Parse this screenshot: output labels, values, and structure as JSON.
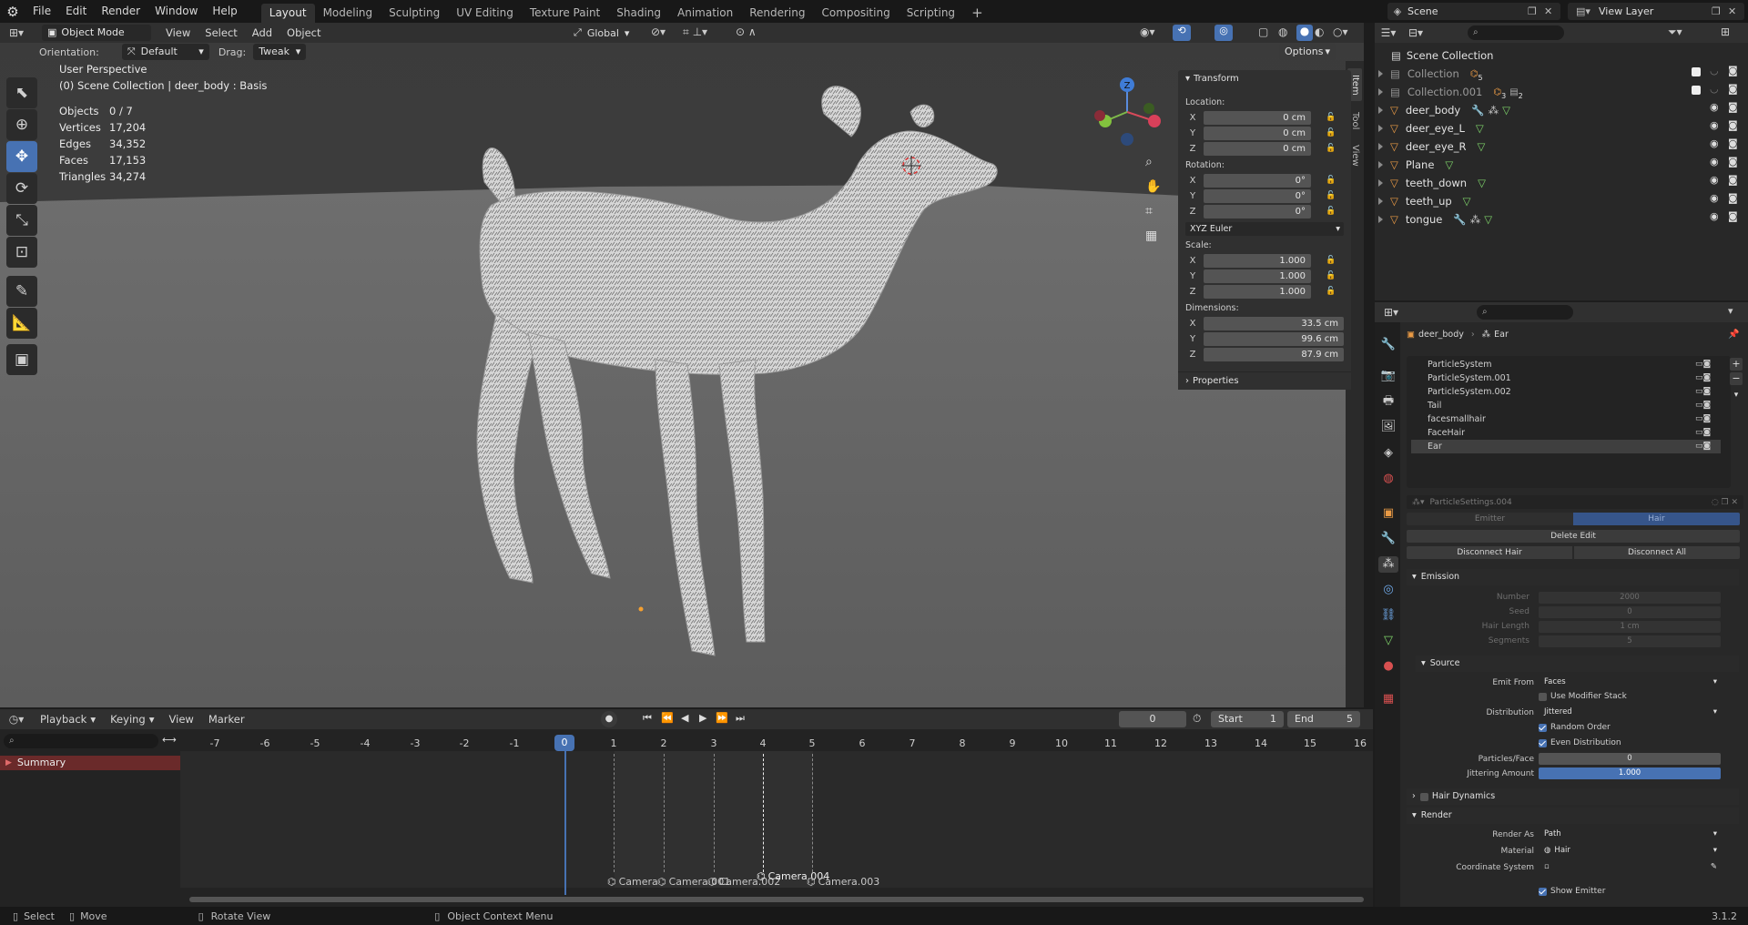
{
  "menu": {
    "items": [
      "File",
      "Edit",
      "Render",
      "Window",
      "Help"
    ]
  },
  "workspaces": {
    "tabs": [
      "Layout",
      "Modeling",
      "Sculpting",
      "UV Editing",
      "Texture Paint",
      "Shading",
      "Animation",
      "Rendering",
      "Compositing",
      "Scripting"
    ],
    "active": "Layout",
    "add": "+"
  },
  "scene": {
    "name": "Scene",
    "view_layer": "View Layer"
  },
  "viewport_header": {
    "mode": "Object Mode",
    "menus": [
      "View",
      "Select",
      "Add",
      "Object"
    ],
    "transform": "Global",
    "options": "Options"
  },
  "tool_settings": {
    "orientation_label": "Orientation:",
    "orientation_value": "Default",
    "drag_label": "Drag:",
    "drag_value": "Tweak"
  },
  "viewport_info": {
    "perspective": "User Perspective",
    "context": "(0) Scene Collection | deer_body : Basis",
    "stats": [
      {
        "key": "Objects",
        "value": "0 / 7"
      },
      {
        "key": "Vertices",
        "value": "17,204"
      },
      {
        "key": "Edges",
        "value": "34,352"
      },
      {
        "key": "Faces",
        "value": "17,153"
      },
      {
        "key": "Triangles",
        "value": "34,274"
      }
    ]
  },
  "npanel": {
    "tabs": [
      "Item",
      "Tool",
      "View"
    ],
    "transform_title": "Transform",
    "location_label": "Location:",
    "location": [
      {
        "axis": "X",
        "value": "0 cm"
      },
      {
        "axis": "Y",
        "value": "0 cm"
      },
      {
        "axis": "Z",
        "value": "0 cm"
      }
    ],
    "rotation_label": "Rotation:",
    "rotation": [
      {
        "axis": "X",
        "value": "0°"
      },
      {
        "axis": "Y",
        "value": "0°"
      },
      {
        "axis": "Z",
        "value": "0°"
      }
    ],
    "rotation_mode": "XYZ Euler",
    "scale_label": "Scale:",
    "scale": [
      {
        "axis": "X",
        "value": "1.000"
      },
      {
        "axis": "Y",
        "value": "1.000"
      },
      {
        "axis": "Z",
        "value": "1.000"
      }
    ],
    "dimensions_label": "Dimensions:",
    "dimensions": [
      {
        "axis": "X",
        "value": "33.5 cm"
      },
      {
        "axis": "Y",
        "value": "99.6 cm"
      },
      {
        "axis": "Z",
        "value": "87.9 cm"
      }
    ],
    "properties_title": "Properties"
  },
  "gizmo": {
    "x": "X",
    "y": "Y",
    "z": "Z"
  },
  "outliner": {
    "root": "Scene Collection",
    "items": [
      {
        "name": "Collection",
        "badge": "5"
      },
      {
        "name": "Collection.001",
        "badge": "3"
      },
      {
        "name": "deer_body"
      },
      {
        "name": "deer_eye_L"
      },
      {
        "name": "deer_eye_R"
      },
      {
        "name": "Plane"
      },
      {
        "name": "teeth_down"
      },
      {
        "name": "teeth_up"
      },
      {
        "name": "tongue"
      }
    ],
    "collection_001_badge2": "2"
  },
  "properties": {
    "breadcrumb_object": "deer_body",
    "breadcrumb_system": "Ear",
    "particle_systems": [
      "ParticleSystem",
      "ParticleSystem.001",
      "ParticleSystem.002",
      "Tail",
      "facesmallhair",
      "FaceHair",
      "Ear"
    ],
    "active_system": "Ear",
    "settings_name": "ParticleSettings.004",
    "type_emitter": "Emitter",
    "type_hair": "Hair",
    "delete_edit": "Delete Edit",
    "disconnect_hair": "Disconnect Hair",
    "disconnect_all": "Disconnect All",
    "emission": {
      "title": "Emission",
      "number_label": "Number",
      "number": "2000",
      "seed_label": "Seed",
      "seed": "0",
      "hair_length_label": "Hair Length",
      "hair_length": "1 cm",
      "segments_label": "Segments",
      "segments": "5"
    },
    "source": {
      "title": "Source",
      "emit_from_label": "Emit From",
      "emit_from": "Faces",
      "use_modifier_stack": "Use Modifier Stack",
      "distribution_label": "Distribution",
      "distribution": "Jittered",
      "random_order": "Random Order",
      "even_distribution": "Even Distribution",
      "particles_face_label": "Particles/Face",
      "particles_face": "0",
      "jittering_label": "Jittering Amount",
      "jittering": "1.000"
    },
    "hair_dynamics": "Hair Dynamics",
    "render": {
      "title": "Render",
      "render_as_label": "Render As",
      "render_as": "Path",
      "material_label": "Material",
      "material": "Hair",
      "coord_label": "Coordinate System",
      "show_emitter": "Show Emitter"
    }
  },
  "timeline": {
    "menus": [
      "Playback",
      "Keying",
      "View",
      "Marker"
    ],
    "current_frame": "0",
    "start_label": "Start",
    "start": "1",
    "end_label": "End",
    "end": "5",
    "ticks": [
      "-7",
      "-6",
      "-5",
      "-4",
      "-3",
      "-2",
      "-1",
      "0",
      "1",
      "2",
      "3",
      "4",
      "5",
      "6",
      "7",
      "8",
      "9",
      "10",
      "11",
      "12",
      "13",
      "14",
      "15",
      "16"
    ],
    "playhead": "0",
    "summary": "Summary",
    "markers": [
      "Camera",
      "Camera.001",
      "Camera.002",
      "Camera.004",
      "Camera.003"
    ]
  },
  "statusbar": {
    "select": "Select",
    "move": "Move",
    "rotate": "Rotate View",
    "context": "Object Context Menu",
    "version": "3.1.2"
  },
  "colors": {
    "accent": "#4772b3",
    "object_orange": "#e99a45",
    "mesh_green": "#7ed36a",
    "background": "#1d1d1d"
  }
}
